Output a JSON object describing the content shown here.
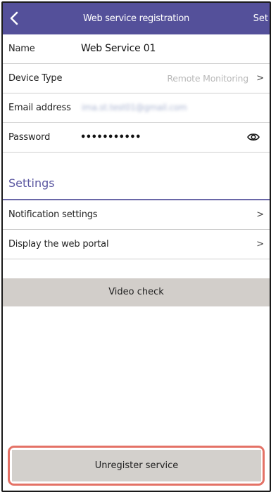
{
  "header": {
    "title": "Web service registration",
    "set_label": "Set",
    "back_icon": "chevron-left-icon",
    "background": "#54509a"
  },
  "fields": {
    "name": {
      "label": "Name",
      "value": "Web Service 01"
    },
    "device_type": {
      "label": "Device Type",
      "value": "Remote Monitoring",
      "icon": "chevron-right-icon"
    },
    "email": {
      "label": "Email address",
      "value": "ima.st.test01@gmail.com"
    },
    "password": {
      "label": "Password",
      "value": "•••••••••••",
      "icon": "eye-icon"
    }
  },
  "settings": {
    "title": "Settings",
    "accent": "#5a56a0",
    "items": [
      {
        "label": "Notification settings",
        "icon": "chevron-right-icon"
      },
      {
        "label": "Display the web portal",
        "icon": "chevron-right-icon"
      }
    ]
  },
  "buttons": {
    "video_check": "Video check",
    "unregister": "Unregister service",
    "highlight_color": "#e47266"
  }
}
